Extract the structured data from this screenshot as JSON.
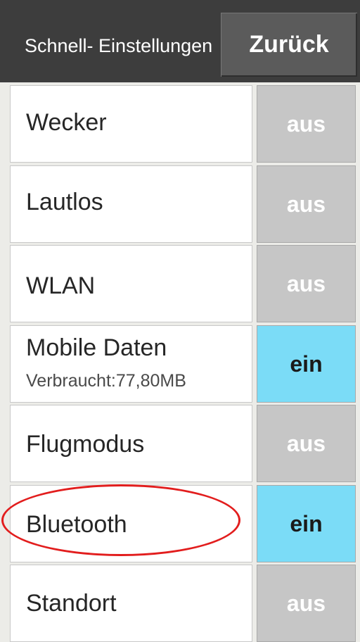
{
  "header": {
    "title": "Schnell- Einstellungen",
    "back_label": "Zurück"
  },
  "items": [
    {
      "label": "Wecker",
      "state": "aus"
    },
    {
      "label": "Lautlos",
      "state": "aus"
    },
    {
      "label": "WLAN",
      "state": "aus"
    },
    {
      "label": "Mobile Daten",
      "sublabel": "Verbraucht:77,80MB",
      "state": "ein"
    },
    {
      "label": "Flugmodus",
      "state": "aus"
    },
    {
      "label": "Bluetooth",
      "state": "ein"
    },
    {
      "label": "Standort",
      "state": "aus"
    }
  ],
  "colors": {
    "on": "#7bdcf7",
    "off": "#c6c6c6",
    "header": "#3d3d3d",
    "highlight": "#e21d1d"
  }
}
